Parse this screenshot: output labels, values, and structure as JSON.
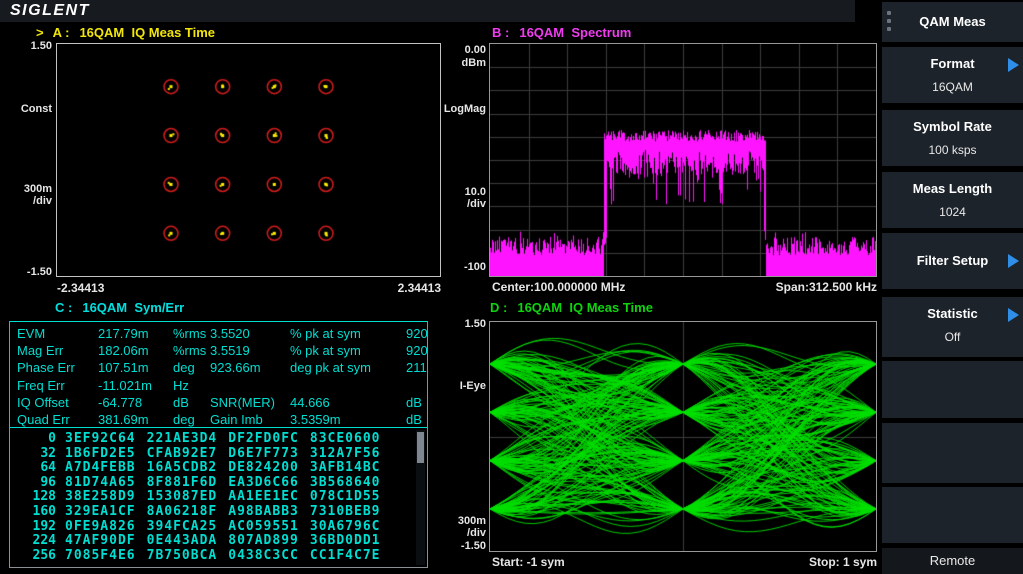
{
  "brand": {
    "logo": "SIGLENT"
  },
  "windows": {
    "a": {
      "marker": ">",
      "head": "A :",
      "title": "16QAM  IQ Meas Time",
      "y_top": "1.50",
      "y_name": "Const",
      "y_scale": "300m",
      "y_scale2": "/div",
      "y_bottom": "-1.50",
      "x_left": "-2.34413",
      "x_right": "2.34413"
    },
    "b": {
      "head": "B :",
      "title": "16QAM  Spectrum",
      "y_top": "0.00",
      "y_unit": "dBm",
      "y_name": "LogMag",
      "y_scale": "10.0",
      "y_scale2": "/div",
      "y_bottom": "-100",
      "x_left": "Center:100.000000 MHz",
      "x_right": "Span:312.500 kHz"
    },
    "c": {
      "head": "C :",
      "title": "16QAM  Sym/Err"
    },
    "d": {
      "head": "D :",
      "title": "16QAM  IQ Meas Time",
      "y_top": "1.50",
      "y_name": "I-Eye",
      "y_scale": "300m",
      "y_scale2": "/div",
      "y_bottom": "-1.50",
      "x_left": "Start: -1 sym",
      "x_right": "Stop: 1 sym"
    }
  },
  "sidebar": {
    "header": "QAM Meas",
    "items": [
      {
        "label": "Format",
        "value": "16QAM",
        "arrow": true
      },
      {
        "label": "Symbol Rate",
        "value": "100 ksps",
        "arrow": false
      },
      {
        "label": "Meas Length",
        "value": "1024",
        "arrow": false
      },
      {
        "label": "Filter Setup",
        "value": "",
        "arrow": true
      },
      {
        "label": "Statistic",
        "value": "Off",
        "arrow": true
      },
      {
        "label": "",
        "value": "",
        "arrow": false
      },
      {
        "label": "",
        "value": "",
        "arrow": false
      },
      {
        "label": "",
        "value": "",
        "arrow": false
      }
    ],
    "footer": "Remote"
  },
  "colors": {
    "yellow": "#f2e60a",
    "magenta": "#f03cf0",
    "cyan": "#00ded2",
    "green": "#0ed30e",
    "trace_magenta": "#ff14ff",
    "trace_green": "#00e000",
    "ring_red": "#d31d1d",
    "dot_yellow": "#ffef00",
    "arrow_blue": "#2f8fe8",
    "grid_gray": "#3c3c3c"
  },
  "chart_data": [
    {
      "id": "constellation",
      "type": "scatter",
      "title": "A: 16QAM IQ Meas Time",
      "xlim": [
        -2.34413,
        2.34413
      ],
      "ylim": [
        -1.5,
        1.5
      ],
      "y_per_div": 0.3,
      "levels": [
        -0.9487,
        -0.3162,
        0.3162,
        0.9487
      ],
      "points": [
        [
          -0.9487,
          0.9487
        ],
        [
          -0.3162,
          0.9487
        ],
        [
          0.3162,
          0.9487
        ],
        [
          0.9487,
          0.9487
        ],
        [
          -0.9487,
          0.3162
        ],
        [
          -0.3162,
          0.3162
        ],
        [
          0.3162,
          0.3162
        ],
        [
          0.9487,
          0.3162
        ],
        [
          -0.9487,
          -0.3162
        ],
        [
          -0.3162,
          -0.3162
        ],
        [
          0.3162,
          -0.3162
        ],
        [
          0.9487,
          -0.3162
        ],
        [
          -0.9487,
          -0.9487
        ],
        [
          -0.3162,
          -0.9487
        ],
        [
          0.3162,
          -0.9487
        ],
        [
          0.9487,
          -0.9487
        ]
      ]
    },
    {
      "id": "spectrum",
      "type": "line",
      "title": "B: 16QAM Spectrum",
      "center": "100.000000 MHz",
      "span": "312.500 kHz",
      "ref_level_dbm": 0,
      "db_per_div": 10,
      "ylim": [
        -100,
        0
      ],
      "grid": true,
      "band_fraction": [
        0.295,
        0.715
      ],
      "plateau_top_dbm": -37,
      "plateau_spread_db": 18,
      "noise_top_dbm": -83,
      "noise_bottom_dbm": -100
    },
    {
      "id": "symerr",
      "type": "table",
      "title": "C: 16QAM Sym/Err",
      "metrics": [
        [
          "EVM",
          "217.79m",
          "%rms",
          "3.5520",
          "% pk at sym",
          "920"
        ],
        [
          "Mag Err",
          "182.06m",
          "%rms",
          "3.5519",
          "% pk at sym",
          "920"
        ],
        [
          "Phase Err",
          "107.51m",
          "deg",
          "923.66m",
          "deg pk at sym",
          "211"
        ],
        [
          "Freq Err",
          "-11.021m",
          "Hz",
          "",
          "",
          ""
        ],
        [
          "IQ Offset",
          "-64.778",
          "dB",
          "SNR(MER)",
          "44.666",
          "dB"
        ],
        [
          "Quad Err",
          "381.69m",
          "deg",
          "Gain Imb",
          "3.5359m",
          "dB"
        ]
      ],
      "hex_offsets": [
        "0",
        "32",
        "64",
        "96",
        "128",
        "160",
        "192",
        "224",
        "256"
      ],
      "hex_rows": [
        [
          "3EF92C64",
          "221AE3D4",
          "DF2FD0FC",
          "83CE0600"
        ],
        [
          "1B6FD2E5",
          "CFAB92E7",
          "D6E7F773",
          "312A7F56"
        ],
        [
          "A7D4FEBB",
          "16A5CDB2",
          "DE824200",
          "3AFB14BC"
        ],
        [
          "81D74A65",
          "8F881F6D",
          "EA3D6C66",
          "3B568640"
        ],
        [
          "38E258D9",
          "153087ED",
          "AA1EE1EC",
          "078C1D55"
        ],
        [
          "329EA1CF",
          "8A06218F",
          "A98BABB3",
          "7310BEB9"
        ],
        [
          "0FE9A826",
          "394FCA25",
          "AC059551",
          "30A6796C"
        ],
        [
          "47AF90DF",
          "0E443ADA",
          "807AD899",
          "36BD0DD1"
        ],
        [
          "7085F4E6",
          "7B750BCA",
          "0438C3CC",
          "CC1F4C7E"
        ]
      ]
    },
    {
      "id": "eye",
      "type": "line",
      "title": "D: 16QAM IQ Meas Time",
      "ylim": [
        -1.5,
        1.5
      ],
      "levels": [
        -0.9487,
        -0.3162,
        0.3162,
        0.9487
      ],
      "x_start_sym": -1,
      "x_stop_sym": 1
    }
  ]
}
